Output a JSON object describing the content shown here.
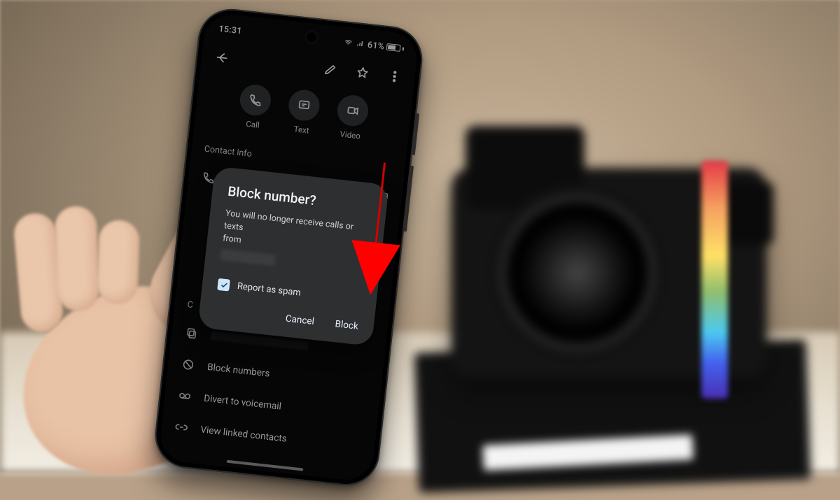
{
  "status": {
    "time": "15:31",
    "battery": "61%"
  },
  "appbar": {},
  "actions": {
    "call": "Call",
    "text": "Text",
    "video": "Video"
  },
  "section": {
    "contact_info": "Contact info"
  },
  "rows": {
    "block_numbers": "Block numbers",
    "divert_voicemail": "Divert to voicemail",
    "view_linked": "View linked contacts"
  },
  "dialog": {
    "title": "Block number?",
    "body_l1": "You will no longer receive calls or texts",
    "body_l2": "from",
    "report_spam": "Report as spam",
    "cancel": "Cancel",
    "block": "Block"
  },
  "peek": {
    "c_letter": "C"
  }
}
